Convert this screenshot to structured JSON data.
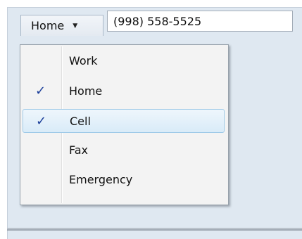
{
  "phone": {
    "type_label": "Home",
    "number": "(998) 558-5525"
  },
  "menu": {
    "items": [
      {
        "label": "Work",
        "checked": false,
        "highlighted": false
      },
      {
        "label": "Home",
        "checked": true,
        "highlighted": false
      },
      {
        "label": "Cell",
        "checked": true,
        "highlighted": true
      },
      {
        "label": "Fax",
        "checked": false,
        "highlighted": false
      },
      {
        "label": "Emergency",
        "checked": false,
        "highlighted": false
      }
    ],
    "check_glyph": "✓"
  },
  "colors": {
    "check": "#1c3f9a",
    "highlight_border": "#9fcae8",
    "window_bg": "#dfe8f1"
  }
}
